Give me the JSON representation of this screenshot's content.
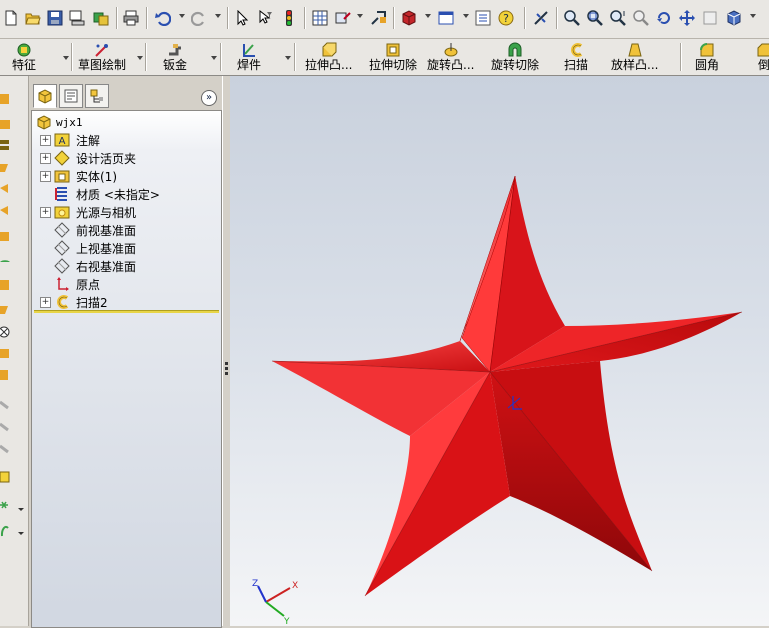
{
  "command_tabs": {
    "features": "特征",
    "sketch": "草图绘制",
    "sheet_metal": "钣金",
    "weldments": "焊件",
    "extruded_boss": "拉伸凸...",
    "extruded_cut": "拉伸切除",
    "revolved_boss": "旋转凸...",
    "revolved_cut": "旋转切除",
    "swept_boss": "扫描",
    "lofted_boss": "放样凸...",
    "fillet": "圆角",
    "chamfer": "倒"
  },
  "tree": {
    "root": "wjx1",
    "items": [
      {
        "label": "注解",
        "icon": "annotations-icon",
        "expandable": true
      },
      {
        "label": "设计活页夹",
        "icon": "design-binder-icon",
        "expandable": true
      },
      {
        "label": "实体(1)",
        "icon": "solid-bodies-icon",
        "expandable": true
      },
      {
        "label": "材质 <未指定>",
        "icon": "material-icon",
        "expandable": false
      },
      {
        "label": "光源与相机",
        "icon": "lights-cameras-icon",
        "expandable": true
      },
      {
        "label": "前视基准面",
        "icon": "plane-icon",
        "expandable": false
      },
      {
        "label": "上视基准面",
        "icon": "plane-icon",
        "expandable": false
      },
      {
        "label": "右视基准面",
        "icon": "plane-icon",
        "expandable": false
      },
      {
        "label": "原点",
        "icon": "origin-icon",
        "expandable": false
      },
      {
        "label": "扫描2",
        "icon": "sweep-icon",
        "expandable": true
      }
    ]
  },
  "panel": {
    "collapse_glyph": "»"
  },
  "triad": {
    "x_label": "X",
    "y_label": "Y",
    "z_label": "Z"
  },
  "colors": {
    "star": "#e3171b",
    "star_dark": "#9c0a0c",
    "star_light": "#ff5a5a",
    "triad_x": "#cc2222",
    "triad_y": "#22aa22",
    "triad_z": "#2233cc"
  }
}
